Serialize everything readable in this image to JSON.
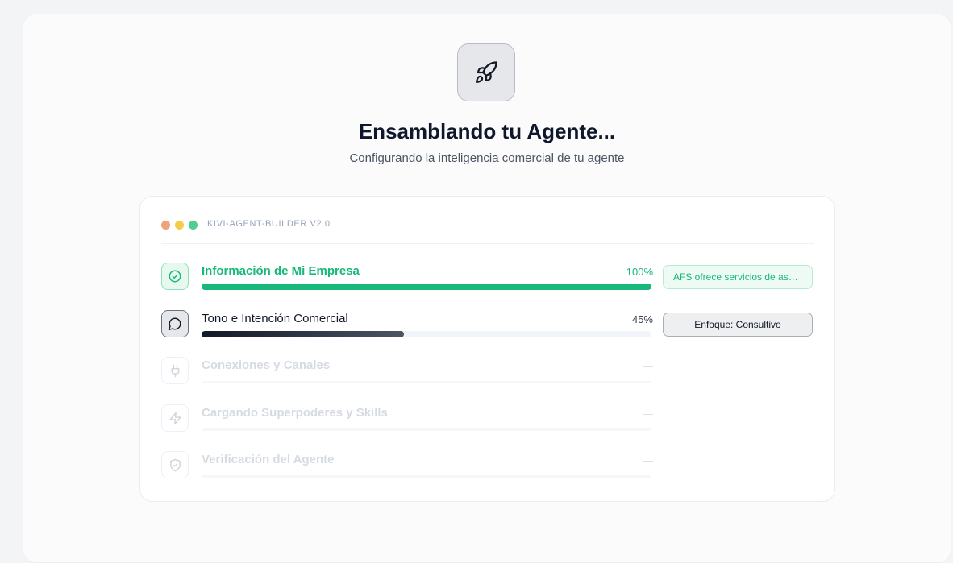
{
  "header": {
    "title": "Ensamblando tu Agente...",
    "subtitle": "Configurando la inteligencia comercial de tu agente",
    "icon": "rocket-icon"
  },
  "builder": {
    "label": "KIVI-AGENT-BUILDER V2.0",
    "window_dots": [
      "#f0a27a",
      "#f5cc4a",
      "#4fcf8f"
    ]
  },
  "colors": {
    "complete": "#17b879",
    "active": "#111827",
    "pending": "#cfd5dd"
  },
  "steps": [
    {
      "label": "Información de Mi Empresa",
      "status": "complete",
      "percent_text": "100%",
      "progress": 1.0,
      "icon": "check-circle-icon",
      "chip": "AFS ofrece servicios de asesoría"
    },
    {
      "label": "Tono e Intención Comercial",
      "status": "active",
      "percent_text": "45%",
      "progress": 0.45,
      "icon": "message-circle-icon",
      "chip": "Enfoque: Consultivo"
    },
    {
      "label": "Conexiones y Canales",
      "status": "pending",
      "percent_text": "—",
      "progress": 0,
      "icon": "plug-icon"
    },
    {
      "label": "Cargando Superpoderes y Skills",
      "status": "pending",
      "percent_text": "—",
      "progress": 0,
      "icon": "zap-icon"
    },
    {
      "label": "Verificación del Agente",
      "status": "pending",
      "percent_text": "—",
      "progress": 0,
      "icon": "shield-check-icon"
    }
  ]
}
